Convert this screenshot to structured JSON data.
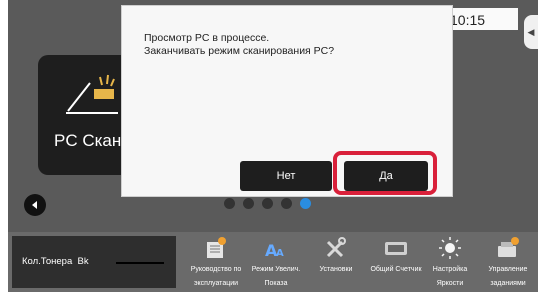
{
  "header": {
    "time": "10:15"
  },
  "tile": {
    "label": "PC Скани"
  },
  "dialog": {
    "line1": "Просмотр PC в процессе.",
    "line2": "Заканчивать режим сканирования PC?",
    "no_label": "Нет",
    "yes_label": "Да"
  },
  "pager": {
    "total": 5,
    "active_index": 4
  },
  "taskbar": {
    "toner_label": "Кол.Тонера",
    "toner_color": "Bk",
    "items": [
      {
        "icon": "manual-icon",
        "line1": "Руководство по",
        "line2": "эксплуатации"
      },
      {
        "icon": "magnify-text-icon",
        "line1": "Режим Увелич.",
        "line2": "Показа"
      },
      {
        "icon": "tools-icon",
        "line1": "Установки",
        "line2": ""
      },
      {
        "icon": "counter-icon",
        "line1": "Общий Счетчик",
        "line2": ""
      },
      {
        "icon": "brightness-icon",
        "line1": "Настройка",
        "line2": "Яркости"
      },
      {
        "icon": "job-status-icon",
        "line1": "Управление",
        "line2": "заданиями"
      }
    ]
  },
  "colors": {
    "highlight": "#d9203a",
    "active_dot": "#2a8de0",
    "button_bg": "#1e1e1e"
  }
}
